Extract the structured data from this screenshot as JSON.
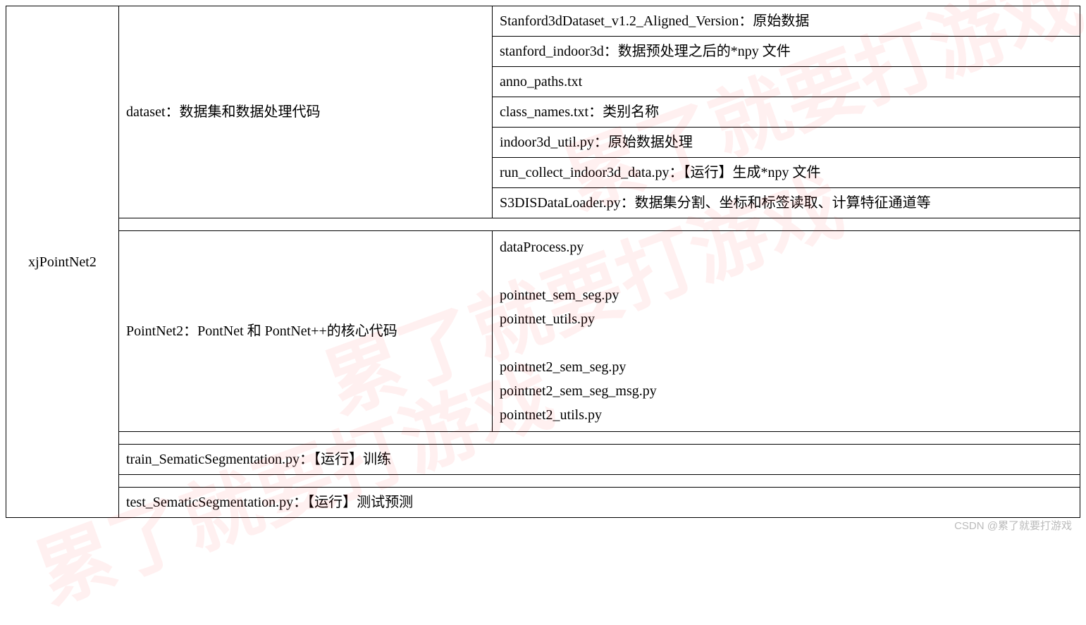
{
  "root_label": "xjPointNet2",
  "dataset_label": "dataset：数据集和数据处理代码",
  "dataset_items": {
    "i0": "Stanford3dDataset_v1.2_Aligned_Version：原始数据",
    "i1": "stanford_indoor3d：数据预处理之后的*npy 文件",
    "i2": "anno_paths.txt",
    "i3": "class_names.txt：类别名称",
    "i4": "indoor3d_util.py：原始数据处理",
    "i5": "run_collect_indoor3d_data.py：【运行】生成*npy 文件",
    "i6": "S3DISDataLoader.py：数据集分割、坐标和标签读取、计算特征通道等"
  },
  "pointnet2_label": "PointNet2：PontNet 和 PontNet++的核心代码",
  "pointnet2_content": "dataProcess.py\n\npointnet_sem_seg.py\npointnet_utils.py\n\npointnet2_sem_seg.py\npointnet2_sem_seg_msg.py\npointnet2_utils.py",
  "train_label": "train_SematicSegmentation.py：【运行】训练",
  "test_label": "test_SematicSegmentation.py：【运行】测试预测",
  "watermark_text": "累了就要打游戏",
  "attribution": "CSDN @累了就要打游戏"
}
